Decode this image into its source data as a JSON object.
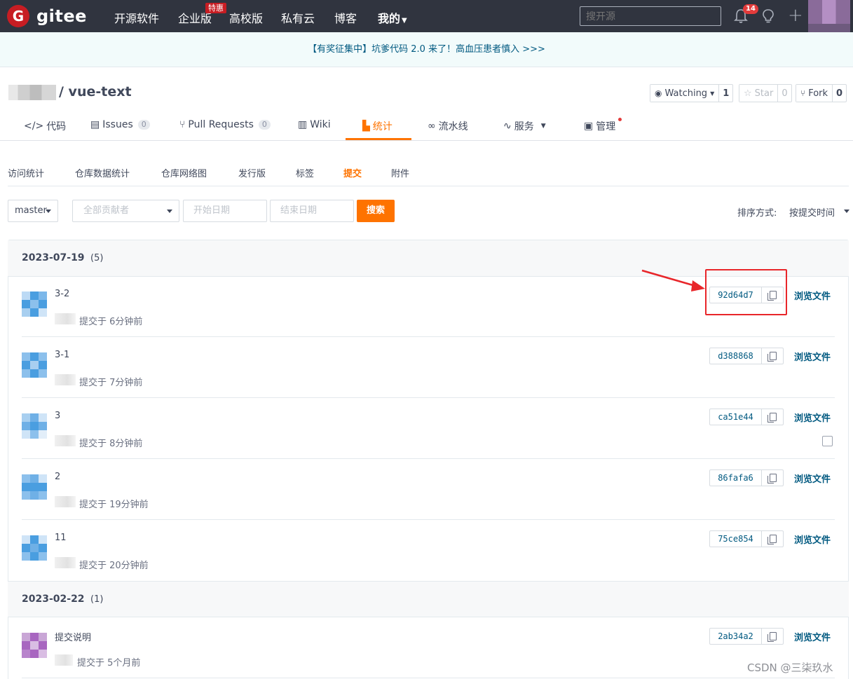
{
  "nav": {
    "logo_text": "gitee",
    "logo_mark": "G",
    "items": [
      "开源软件",
      "企业版",
      "高校版",
      "私有云",
      "博客",
      "我的"
    ],
    "enterprise_badge": "特惠",
    "search_placeholder": "搜开源",
    "notification_count": "14",
    "icons": [
      "bell-icon",
      "lightbulb-icon",
      "plus-icon"
    ]
  },
  "announcement": "【有奖征集中】坑爹代码 2.0 来了！高血压患者慎入 >>>",
  "repo": {
    "name": "/ vue-text",
    "watching_label": "Watching",
    "watching_count": "1",
    "star_label": "Star",
    "star_count": "0",
    "fork_label": "Fork",
    "fork_count": "0"
  },
  "tabs": [
    {
      "label": "代码",
      "icon": "code-icon"
    },
    {
      "label": "Issues",
      "count": "0",
      "icon": "issue-icon"
    },
    {
      "label": "Pull Requests",
      "count": "0",
      "icon": "pull-request-icon"
    },
    {
      "label": "Wiki",
      "icon": "wiki-icon"
    },
    {
      "label": "统计",
      "icon": "chart-icon",
      "active": true
    },
    {
      "label": "流水线",
      "icon": "pipeline-icon"
    },
    {
      "label": "服务",
      "icon": "pulse-icon"
    },
    {
      "label": "管理",
      "icon": "document-icon"
    }
  ],
  "subnav": [
    "访问统计",
    "仓库数据统计",
    "仓库网络图",
    "发行版",
    "标签",
    "提交",
    "附件"
  ],
  "filters": {
    "branch": "master",
    "contributor_placeholder": "全部贡献者",
    "start_date_placeholder": "开始日期",
    "end_date_placeholder": "结束日期",
    "search_label": "搜索",
    "sort_label": "排序方式:",
    "sort_value": "按提交时间"
  },
  "groups": [
    {
      "date": "2023-07-19",
      "count": "(5)",
      "commits": [
        {
          "message": "3-2",
          "meta": "提交于 6分钟前",
          "sha": "92d64d7",
          "browse": "浏览文件"
        },
        {
          "message": "3-1",
          "meta": "提交于 7分钟前",
          "sha": "d388868",
          "browse": "浏览文件"
        },
        {
          "message": "3",
          "meta": "提交于 8分钟前",
          "sha": "ca51e44",
          "browse": "浏览文件"
        },
        {
          "message": "2",
          "meta": "提交于 19分钟前",
          "sha": "86fafa6",
          "browse": "浏览文件"
        },
        {
          "message": "11",
          "meta": "提交于 20分钟前",
          "sha": "75ce854",
          "browse": "浏览文件"
        }
      ]
    },
    {
      "date": "2023-02-22",
      "count": "(1)",
      "commits": [
        {
          "message": "提交说明",
          "meta": "提交于 5个月前",
          "sha": "2ab34a2",
          "browse": "浏览文件"
        }
      ]
    }
  ],
  "watermark": "CSDN @三柒玖水",
  "colors": {
    "accent": "#fe7300",
    "nav_bg": "#30343f",
    "link": "#005980",
    "annotation_red": "#e8262a"
  }
}
